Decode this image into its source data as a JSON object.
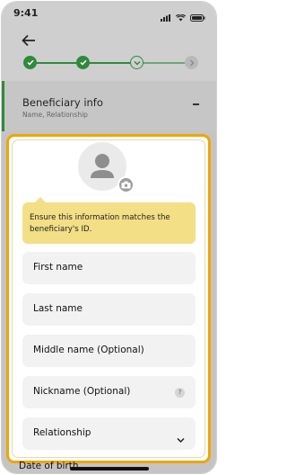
{
  "status_bar": {
    "time": "9:41",
    "icons": [
      "signal-icon",
      "wifi-icon",
      "battery-icon"
    ]
  },
  "app_bar": {
    "back_icon": "arrow-left-icon",
    "stepper": {
      "steps": [
        {
          "state": "complete",
          "icon": "check-icon"
        },
        {
          "state": "complete",
          "icon": "check-icon"
        },
        {
          "state": "current",
          "icon": "chevron-down-icon"
        },
        {
          "state": "upcoming",
          "icon": "chevron-right-icon"
        }
      ]
    }
  },
  "section": {
    "title": "Beneficiary info",
    "subtitle": "Name, Relationship",
    "toggle_icon": "minus-icon"
  },
  "profile_photo": {
    "avatar_icon": "person-icon",
    "badge_icon": "camera-icon"
  },
  "notice": {
    "text": "Ensure this information matches the beneficiary's ID."
  },
  "form": {
    "first_name": "First name",
    "last_name": "Last name",
    "middle_name": "Middle name (Optional)",
    "nickname": "Nickname (Optional)",
    "nickname_help": "?",
    "relationship": "Relationship"
  },
  "next_field_peek": "Date of birth",
  "colors": {
    "accent_green": "#2f8a3c",
    "highlight_orange": "#f0a500",
    "notice_yellow": "#f3df86"
  }
}
